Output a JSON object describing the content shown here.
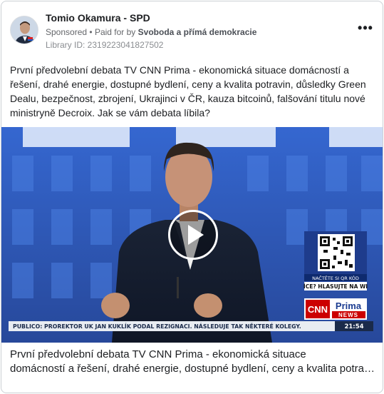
{
  "ad": {
    "page_name": "Tomio Okamura - SPD",
    "sponsored": "Sponsored",
    "paid_for_by_prefix": "Paid for by",
    "paid_for_by_name": "Svoboda a přímá demokracie",
    "library_id": "Library ID: 2319223041827502",
    "more_icon": "more-options-icon",
    "body_text": "První předvolební debata TV CNN Prima - ekonomická situace domácností a řešení, drahé energie, dostupné bydlení, ceny a kvalita potravin, důsledky Green Dealu, bezpečnost, zbrojení, Ukrajinci v ČR, kauza bitcoinů, falšování titulu nové ministryně Decroix. Jak se vám debata líbila?",
    "caption_line1": "První předvolební debata TV CNN Prima - ekonomická situace",
    "caption_line2": "domácností a řešení, drahé energie, dostupné bydlení, ceny a kvalita potravin"
  },
  "video": {
    "play_icon": "play-icon",
    "ticker": "PUBLICO: PROREKTOR UK JAN KUKLÍK PODAL REZIGNACI. NÁSLEDUJE TAK NĚKTERÉ KOLEGY.",
    "clock": "21:54",
    "qr_top": "NAČTĚTE SI QR KÓD",
    "qr_bottom": "ÍCE? HLASUJTE NA WI",
    "logo_cnn": "CNN",
    "logo_prima": "Prima",
    "logo_news": "NEWS",
    "colors": {
      "background": "#2d58b8",
      "ticker": "#e8ecf2",
      "clock": "#1a2a4a",
      "cnn_red": "#cc0000"
    }
  }
}
